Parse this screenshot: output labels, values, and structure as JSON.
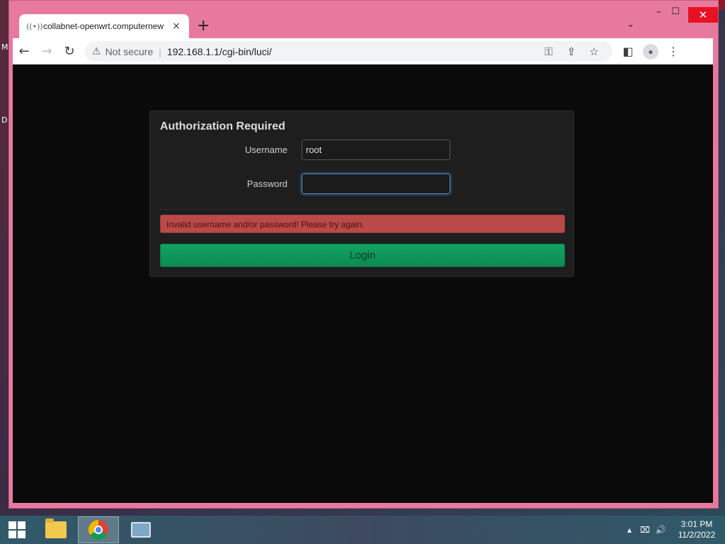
{
  "desktop": {
    "letters": [
      "M",
      "D"
    ]
  },
  "browser": {
    "tab": {
      "title": "collabnet-openwrt.computernew",
      "favicon": "wireless-broadcast-icon",
      "close": "×"
    },
    "new_tab": "+",
    "tab_search": "⌄",
    "window_controls": {
      "minimize": "–",
      "maximize": "☐",
      "close": "✕"
    },
    "nav": {
      "back": "←",
      "forward": "→",
      "reload": "↻"
    },
    "omnibox": {
      "security_icon": "⚠",
      "security_label": "Not secure",
      "separator": "|",
      "url": "192.168.1.1/cgi-bin/luci/",
      "key_icon": "⚿",
      "share_icon": "⇪",
      "bookmark_icon": "☆"
    },
    "toolbar_icons": {
      "side_panel": "◧",
      "profile": "●",
      "menu": "⋮"
    }
  },
  "page": {
    "heading": "Authorization Required",
    "username_label": "Username",
    "username_value": "root",
    "password_label": "Password",
    "password_value": "",
    "error_message": "Invalid username and/or password! Please try again.",
    "login_button": "Login"
  },
  "colors": {
    "frame": "#e8799e",
    "page_bg": "#0a0a0a",
    "card_bg": "#1e1e1e",
    "alert_bg": "#b94a48",
    "login_bg": "#0f9a5b"
  },
  "taskbar": {
    "apps": [
      "file-explorer-icon",
      "chrome-icon",
      "system-monitor-icon"
    ],
    "tray_icons": {
      "overflow": "▴",
      "network": "⌧",
      "volume": "🔊"
    },
    "time": "3:01 PM",
    "date": "11/2/2022"
  }
}
